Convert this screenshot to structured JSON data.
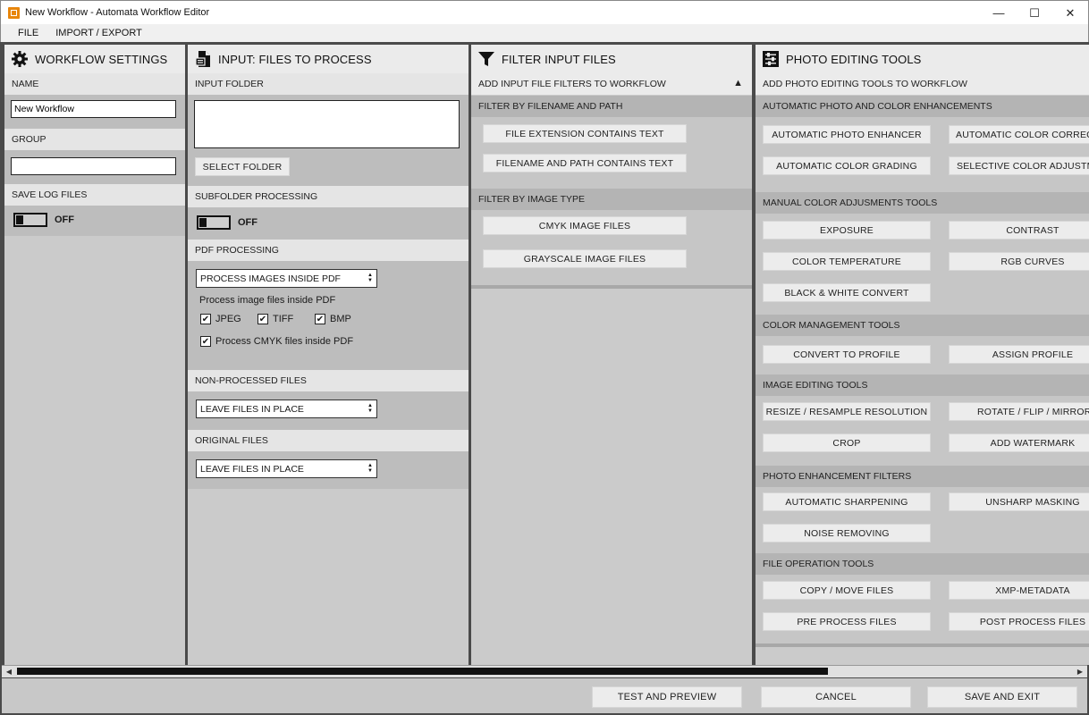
{
  "window": {
    "title": "New Workflow - Automata Workflow Editor",
    "min_label": "—",
    "max_label": "☐",
    "close_label": "✕"
  },
  "menu": [
    "FILE",
    "IMPORT / EXPORT"
  ],
  "workflow_settings": {
    "title": "WORKFLOW SETTINGS",
    "name_label": "NAME",
    "name_value": "New Workflow",
    "group_label": "GROUP",
    "group_value": "",
    "save_log_label": "SAVE LOG FILES",
    "save_log_state": "OFF"
  },
  "input_files": {
    "title": "INPUT: FILES TO PROCESS",
    "input_folder_label": "INPUT FOLDER",
    "select_folder_button": "SELECT FOLDER",
    "subfolder_label": "SUBFOLDER PROCESSING",
    "subfolder_state": "OFF",
    "pdf_label": "PDF PROCESSING",
    "pdf_select": "PROCESS IMAGES INSIDE PDF",
    "pdf_note": "Process image files inside PDF",
    "cb_jpeg": "JPEG",
    "cb_tiff": "TIFF",
    "cb_bmp": "BMP",
    "cb_cmyk": "Process CMYK files inside PDF",
    "non_processed_label": "NON-PROCESSED FILES",
    "non_processed_select": "LEAVE FILES IN PLACE",
    "original_label": "ORIGINAL FILES",
    "original_select": "LEAVE FILES IN PLACE"
  },
  "filter": {
    "title": "FILTER INPUT FILES",
    "add_label": "ADD INPUT FILE FILTERS TO WORKFLOW",
    "sec1": "FILTER BY FILENAME AND PATH",
    "btn_ext": "FILE EXTENSION CONTAINS TEXT",
    "btn_path": "FILENAME AND PATH CONTAINS TEXT",
    "sec2": "FILTER BY IMAGE TYPE",
    "btn_cmyk": "CMYK IMAGE FILES",
    "btn_gray": "GRAYSCALE IMAGE FILES"
  },
  "tools": {
    "title": "PHOTO EDITING TOOLS",
    "add_label": "ADD PHOTO EDITING TOOLS TO WORKFLOW",
    "sec_auto": "AUTOMATIC PHOTO AND COLOR ENHANCEMENTS",
    "auto_enhancer": "AUTOMATIC PHOTO ENHANCER",
    "auto_color_correction": "AUTOMATIC COLOR CORRECTION",
    "auto_grading": "AUTOMATIC COLOR GRADING",
    "selective_color": "SELECTIVE COLOR ADJUSTMENT",
    "sec_manual": "MANUAL COLOR ADJUSMENTS TOOLS",
    "exposure": "EXPOSURE",
    "contrast": "CONTRAST",
    "color_temp": "COLOR TEMPERATURE",
    "rgb_curves": "RGB CURVES",
    "bw_convert": "BLACK & WHITE CONVERT",
    "sec_cm": "COLOR MANAGEMENT TOOLS",
    "convert_profile": "CONVERT TO PROFILE",
    "assign_profile": "ASSIGN PROFILE",
    "sec_edit": "IMAGE EDITING TOOLS",
    "resize": "RESIZE / RESAMPLE RESOLUTION",
    "rotate": "ROTATE / FLIP / MIRROR",
    "crop": "CROP",
    "watermark": "ADD WATERMARK",
    "sec_enh": "PHOTO ENHANCEMENT FILTERS",
    "sharpen": "AUTOMATIC SHARPENING",
    "unsharp": "UNSHARP MASKING",
    "noise": "NOISE REMOVING",
    "sec_file": "FILE OPERATION TOOLS",
    "copy_move": "COPY / MOVE FILES",
    "xmp": "XMP-METADATA",
    "pre_process": "PRE PROCESS FILES",
    "post_process": "POST PROCESS FILES"
  },
  "footer": {
    "test": "TEST AND PREVIEW",
    "cancel": "CANCEL",
    "save": "SAVE AND EXIT"
  }
}
